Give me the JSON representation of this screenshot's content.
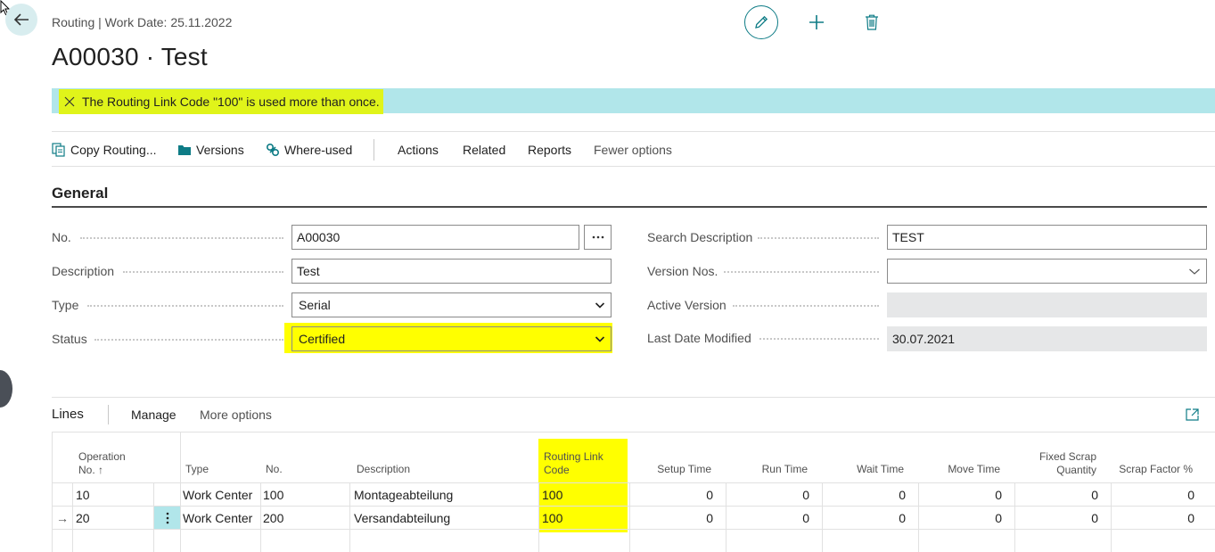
{
  "header": {
    "breadcrumb": "Routing | Work Date: 25.11.2022",
    "title": "A00030 · Test"
  },
  "message": {
    "text": "The Routing Link Code \"100\" is used more than once."
  },
  "actions": {
    "copy_routing": "Copy Routing...",
    "versions": "Versions",
    "where_used": "Where-used",
    "actions": "Actions",
    "related": "Related",
    "reports": "Reports",
    "fewer_options": "Fewer options"
  },
  "general": {
    "title": "General",
    "no_label": "No.",
    "no_value": "A00030",
    "description_label": "Description",
    "description_value": "Test",
    "type_label": "Type",
    "type_value": "Serial",
    "status_label": "Status",
    "status_value": "Certified",
    "search_description_label": "Search Description",
    "search_description_value": "TEST",
    "version_nos_label": "Version Nos.",
    "version_nos_value": "",
    "active_version_label": "Active Version",
    "active_version_value": "",
    "last_date_modified_label": "Last Date Modified",
    "last_date_modified_value": "30.07.2021"
  },
  "lines": {
    "title": "Lines",
    "manage": "Manage",
    "more_options": "More options",
    "columns": {
      "operation_no_1": "Operation",
      "operation_no_2": "No. ↑",
      "type": "Type",
      "no": "No.",
      "description": "Description",
      "routing_link_code_1": "Routing Link",
      "routing_link_code_2": "Code",
      "setup_time": "Setup Time",
      "run_time": "Run Time",
      "wait_time": "Wait Time",
      "move_time": "Move Time",
      "fixed_scrap_1": "Fixed Scrap",
      "fixed_scrap_2": "Quantity",
      "scrap_factor": "Scrap Factor %"
    },
    "rows": [
      {
        "marker": "",
        "operation_no": "10",
        "type": "Work Center",
        "no": "100",
        "description": "Montageabteilung",
        "routing_link_code": "100",
        "setup_time": "0",
        "run_time": "0",
        "wait_time": "0",
        "move_time": "0",
        "fixed_scrap": "0",
        "scrap_factor": "0"
      },
      {
        "marker": "→",
        "operation_no": "20",
        "type": "Work Center",
        "no": "200",
        "description": "Versandabteilung",
        "routing_link_code": "100",
        "setup_time": "0",
        "run_time": "0",
        "wait_time": "0",
        "move_time": "0",
        "fixed_scrap": "0",
        "scrap_factor": "0"
      }
    ]
  },
  "colors": {
    "accent": "#0e7c86",
    "message_bar": "#b1e6ea",
    "highlight_yellow": "#ffff00"
  }
}
